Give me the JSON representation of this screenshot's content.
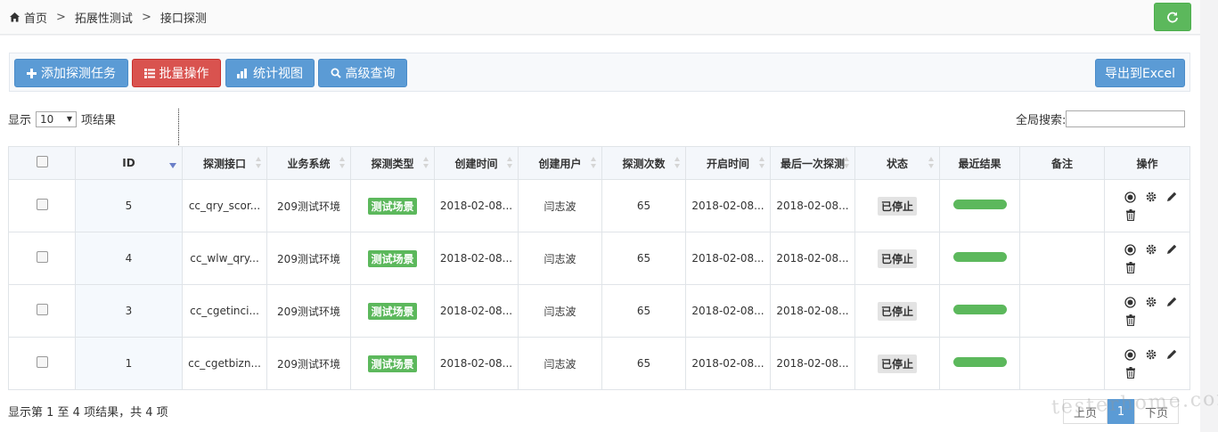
{
  "breadcrumb": [
    "首页",
    "拓展性测试",
    "接口探测"
  ],
  "toolbar": {
    "add_label": "添加探测任务",
    "batch_label": "批量操作",
    "stats_label": "统计视图",
    "advanced_label": "高级查询",
    "export_label": "导出到Excel"
  },
  "length": {
    "prefix": "显示",
    "value": "10",
    "suffix": "项结果"
  },
  "search": {
    "label": "全局搜索:",
    "value": ""
  },
  "table": {
    "headers": [
      "ID",
      "探测接口",
      "业务系统",
      "探测类型",
      "创建时间",
      "创建用户",
      "探测次数",
      "开启时间",
      "最后一次探测",
      "状态",
      "最近结果",
      "备注",
      "操作"
    ],
    "rows": [
      {
        "id": "5",
        "api": "cc_qry_scor...",
        "system": "209测试环境",
        "type": "测试场景",
        "created": "2018-02-08...",
        "user": "闫志波",
        "count": "65",
        "started": "2018-02-08...",
        "last": "2018-02-08...",
        "status": "已停止",
        "note": ""
      },
      {
        "id": "4",
        "api": "cc_wlw_qry...",
        "system": "209测试环境",
        "type": "测试场景",
        "created": "2018-02-08...",
        "user": "闫志波",
        "count": "65",
        "started": "2018-02-08...",
        "last": "2018-02-08...",
        "status": "已停止",
        "note": ""
      },
      {
        "id": "3",
        "api": "cc_cgetinci...",
        "system": "209测试环境",
        "type": "测试场景",
        "created": "2018-02-08...",
        "user": "闫志波",
        "count": "65",
        "started": "2018-02-08...",
        "last": "2018-02-08...",
        "status": "已停止",
        "note": ""
      },
      {
        "id": "1",
        "api": "cc_cgetbizn...",
        "system": "209测试环境",
        "type": "测试场景",
        "created": "2018-02-08...",
        "user": "闫志波",
        "count": "65",
        "started": "2018-02-08...",
        "last": "2018-02-08...",
        "status": "已停止",
        "note": ""
      }
    ]
  },
  "info": "显示第 1 至 4 项结果，共 4 项",
  "pager": {
    "prev": "上页",
    "current": "1",
    "next": "下页"
  },
  "watermark": "testerhome.com",
  "colors": {
    "green": "#5cb85c",
    "blue": "#5b9bd5",
    "red": "#d9534f"
  },
  "icons": [
    "home-icon",
    "refresh-icon",
    "plus-icon",
    "list-icon",
    "bar-chart-icon",
    "search-icon",
    "view-icon",
    "gear-icon",
    "pencil-icon",
    "trash-icon"
  ]
}
